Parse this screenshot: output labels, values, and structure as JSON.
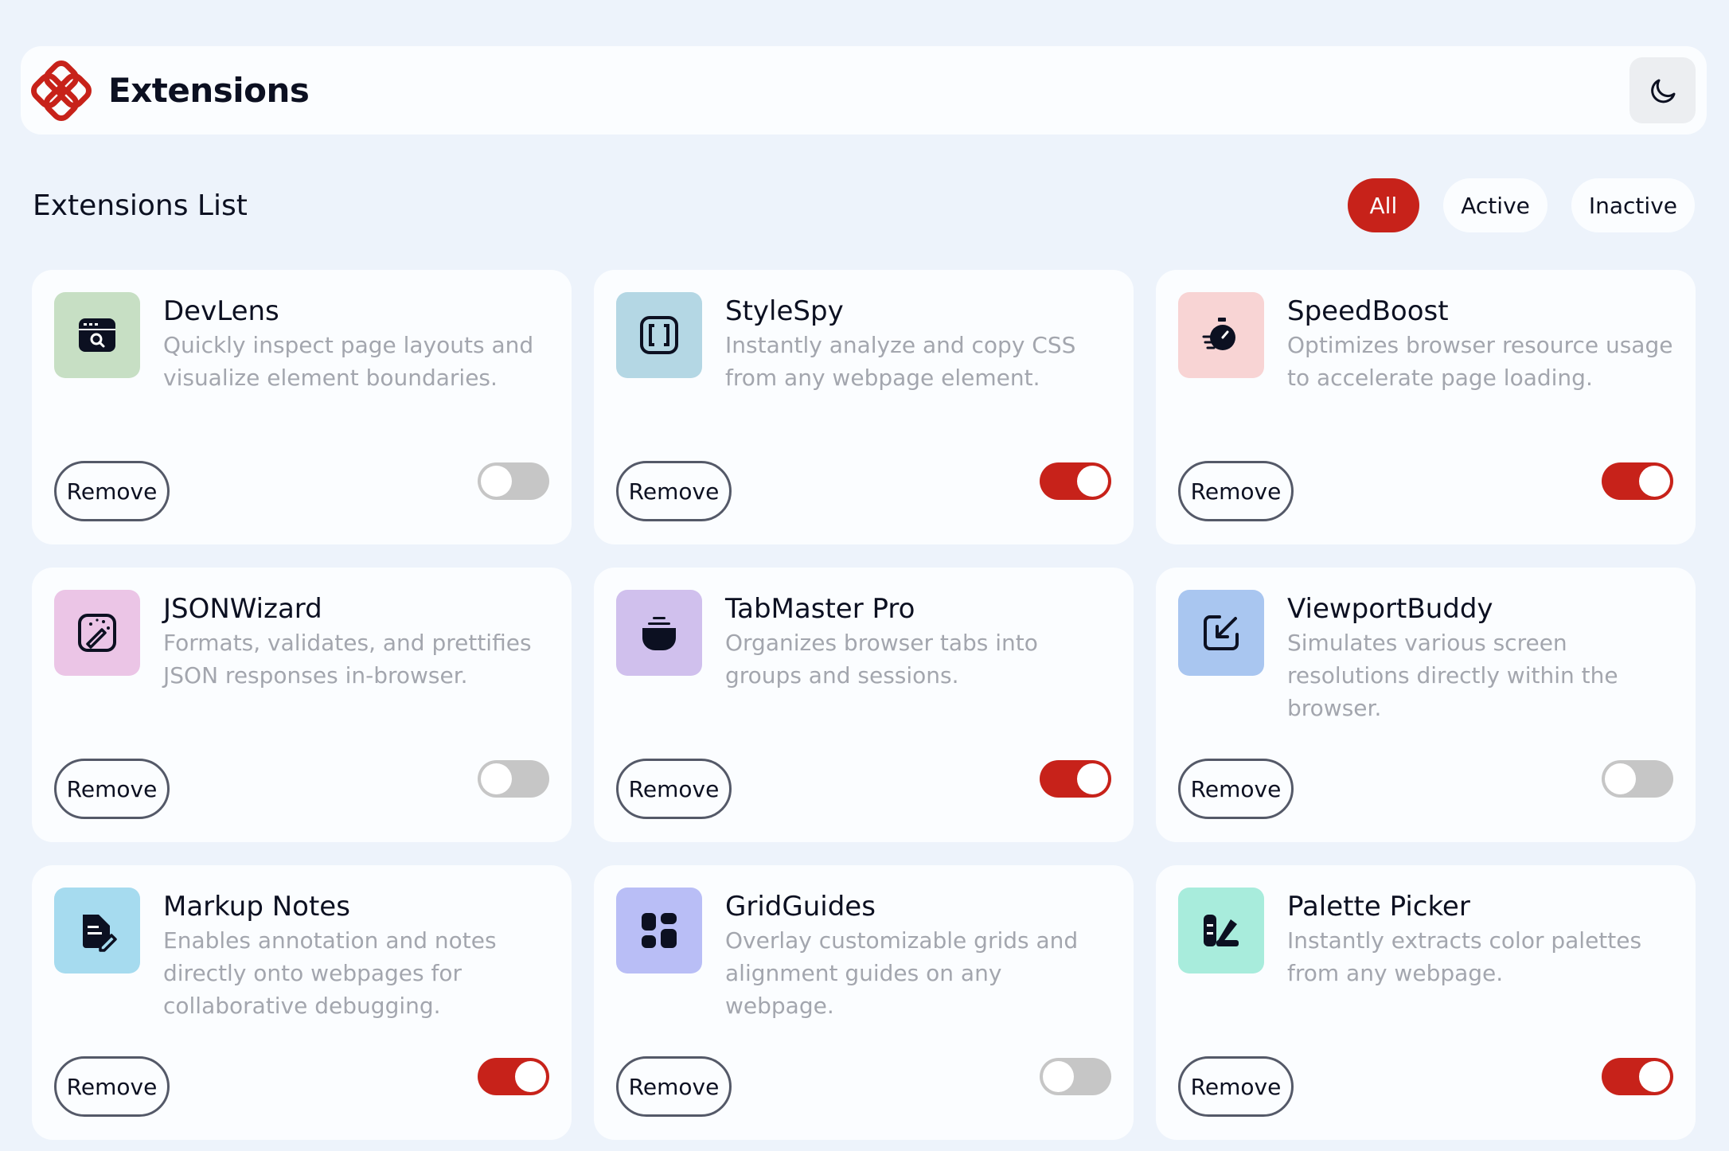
{
  "header": {
    "title": "Extensions",
    "logo_icon": "extensions-logo",
    "theme_toggle_icon": "moon-icon"
  },
  "list": {
    "title": "Extensions List",
    "filters": [
      {
        "label": "All",
        "selected": true
      },
      {
        "label": "Active",
        "selected": false
      },
      {
        "label": "Inactive",
        "selected": false
      }
    ]
  },
  "colors": {
    "accent": "#c7221a",
    "background": "#edf3fb",
    "card": "#fbfdff",
    "toggle_off": "#c6c6c6"
  },
  "extensions": [
    {
      "name": "DevLens",
      "description": "Quickly inspect page layouts and visualize element boundaries.",
      "remove_label": "Remove",
      "active": false,
      "icon": "browser-search-icon",
      "icon_bg": "#c7dfc4"
    },
    {
      "name": "StyleSpy",
      "description": "Instantly analyze and copy CSS from any webpage element.",
      "remove_label": "Remove",
      "active": true,
      "icon": "brackets-icon",
      "icon_bg": "#b4d7e4"
    },
    {
      "name": "SpeedBoost",
      "description": "Optimizes browser resource usage to accelerate page loading.",
      "remove_label": "Remove",
      "active": true,
      "icon": "stopwatch-icon",
      "icon_bg": "#f8d4d4"
    },
    {
      "name": "JSONWizard",
      "description": "Formats, validates, and prettifies JSON responses in-browser.",
      "remove_label": "Remove",
      "active": false,
      "icon": "wand-image-icon",
      "icon_bg": "#ebc5e6"
    },
    {
      "name": "TabMaster Pro",
      "description": "Organizes browser tabs into groups and sessions.",
      "remove_label": "Remove",
      "active": true,
      "icon": "stack-icon",
      "icon_bg": "#d0c0ed"
    },
    {
      "name": "ViewportBuddy",
      "description": "Simulates various screen resolutions directly within the browser.",
      "remove_label": "Remove",
      "active": false,
      "icon": "resize-arrow-icon",
      "icon_bg": "#a9c6f0"
    },
    {
      "name": "Markup Notes",
      "description": "Enables annotation and notes directly onto webpages for collaborative debugging.",
      "remove_label": "Remove",
      "active": true,
      "icon": "note-pen-icon",
      "icon_bg": "#a6dbef"
    },
    {
      "name": "GridGuides",
      "description": "Overlay customizable grids and alignment guides on any webpage.",
      "remove_label": "Remove",
      "active": false,
      "icon": "grid-blocks-icon",
      "icon_bg": "#b9bef6"
    },
    {
      "name": "Palette Picker",
      "description": "Instantly extracts color palettes from any webpage.",
      "remove_label": "Remove",
      "active": true,
      "icon": "palette-icon",
      "icon_bg": "#a8ecdc"
    }
  ]
}
